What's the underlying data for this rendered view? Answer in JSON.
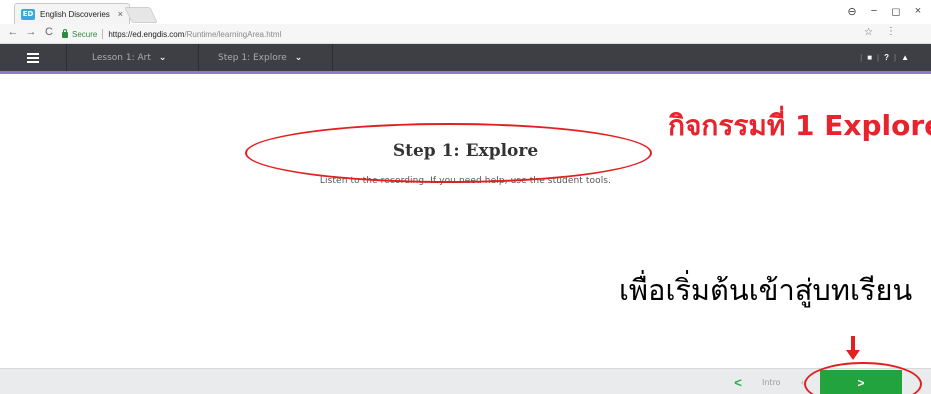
{
  "browser": {
    "tab": {
      "favicon": "ED",
      "title": "English Discoveries",
      "close": "×"
    },
    "window_controls": {
      "account": "⊖",
      "minimize": "−",
      "maximize": "◻",
      "close": "×"
    },
    "nav": {
      "back": "←",
      "forward": "→",
      "reload": "C"
    },
    "address": {
      "secure_label": "Secure",
      "host": "https://ed.engdis.com",
      "path": "/Runtime/learningArea.html"
    },
    "star": "☆",
    "menu": "⋮"
  },
  "appbar": {
    "breadcrumb": [
      {
        "label": "Lesson 1: Art",
        "chevron": "⌄"
      },
      {
        "label": "Step 1: Explore",
        "chevron": "⌄"
      }
    ],
    "tools": {
      "notes": "■",
      "help": "?",
      "user": "▲",
      "divider": "|"
    }
  },
  "main": {
    "title": "Step 1: Explore",
    "instruction": "Listen to the recording. If you need help, use the student tools."
  },
  "annotations": {
    "activity_label": "กิจกรรมที่ 1 Explore",
    "start_label": "เพื่อเริ่มต้นเข้าสู่บทเรียน",
    "color": "#e32020"
  },
  "footer": {
    "prev": "<",
    "intro": "Intro",
    "intro_sep": "‹",
    "next": ">"
  },
  "colors": {
    "appbar": "#3d3f44",
    "appbar_accent": "#8b78d8",
    "next_button": "#22a33e"
  }
}
